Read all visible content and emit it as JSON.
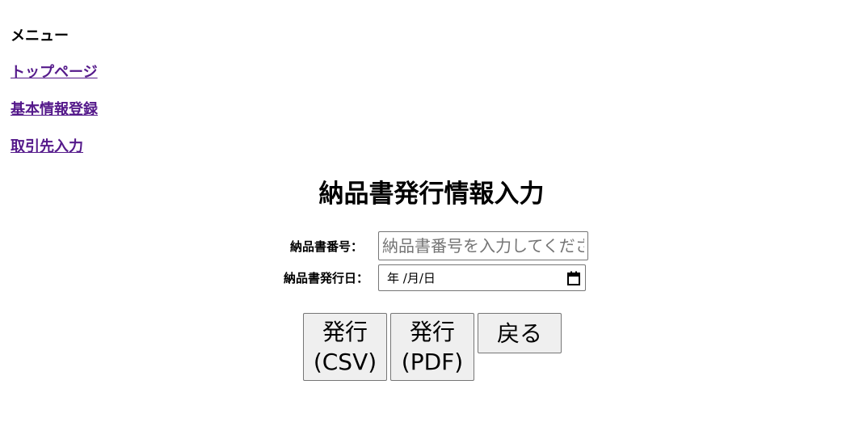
{
  "sidebar": {
    "title": "メニュー",
    "links": [
      {
        "label": "トップページ"
      },
      {
        "label": "基本情報登録"
      },
      {
        "label": "取引先入力"
      }
    ]
  },
  "page": {
    "title": "納品書発行情報入力"
  },
  "form": {
    "invoice_number": {
      "label": "納品書番号：",
      "placeholder": "納品書番号を入力してください",
      "value": ""
    },
    "issue_date": {
      "label": "納品書発行日：",
      "display": "年 /月/日",
      "icon": "calendar-icon"
    }
  },
  "buttons": {
    "csv": "発行\n(CSV)",
    "pdf": "発行\n(PDF)",
    "back": "戻る"
  },
  "colors": {
    "link_visited": "#551a8b",
    "button_bg": "#efefef",
    "border": "#767676"
  }
}
